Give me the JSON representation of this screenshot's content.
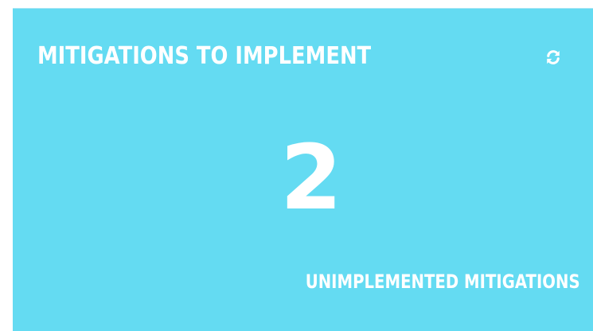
{
  "widget": {
    "title": "MITIGATIONS TO IMPLEMENT",
    "refresh_icon": "refresh-icon",
    "value": "2",
    "label": "UNIMPLEMENTED MITIGATIONS",
    "background_color": "#64dbf2",
    "text_color": "#ffffff"
  }
}
